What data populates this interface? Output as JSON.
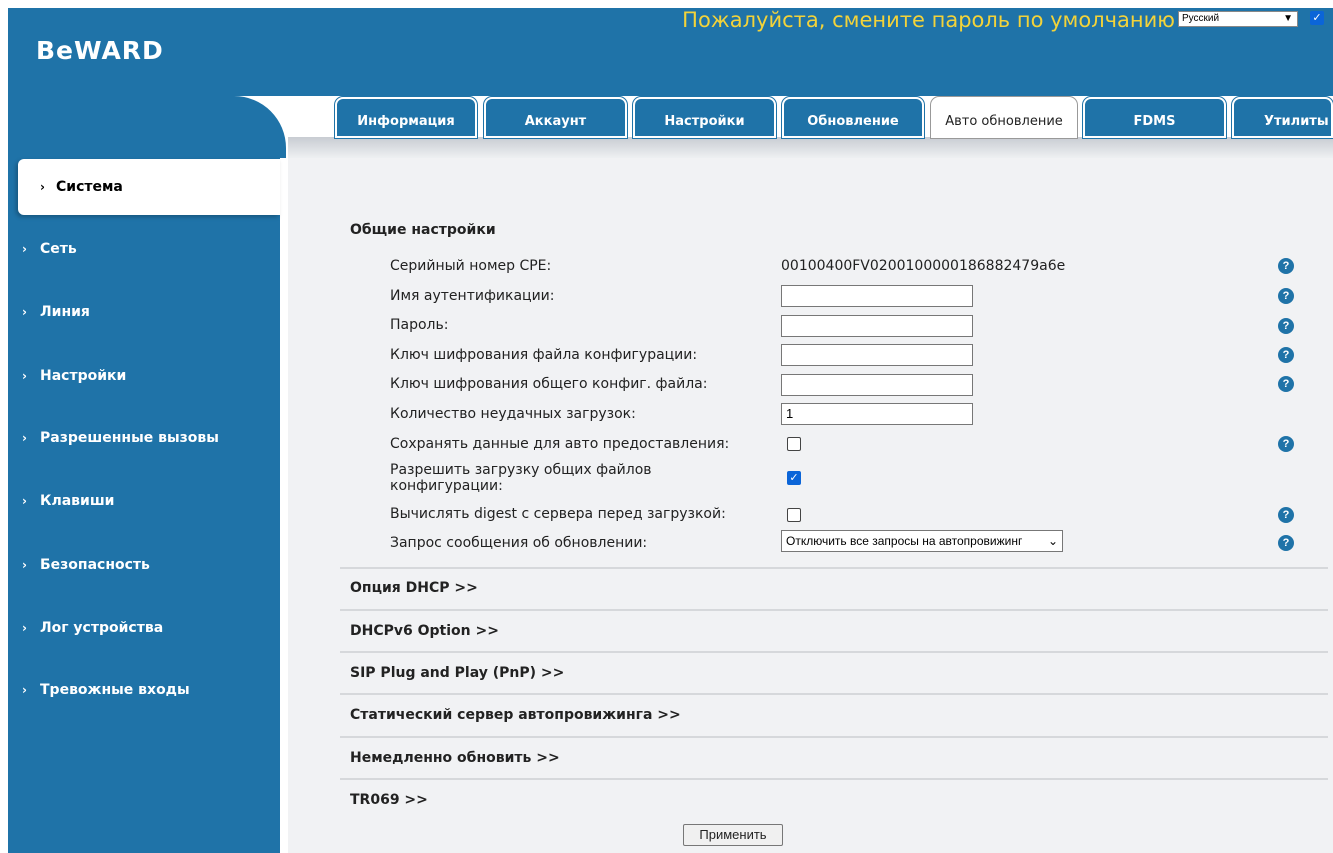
{
  "header": {
    "logo": "BeWARD",
    "password_warning": "Пожалуйста, смените пароль по умолчанию",
    "language": "Русский"
  },
  "sidebar": {
    "items": [
      {
        "label": "Система",
        "active": true
      },
      {
        "label": "Сеть"
      },
      {
        "label": "Линия"
      },
      {
        "label": "Настройки"
      },
      {
        "label": "Разрешенные вызовы"
      },
      {
        "label": "Клавиши"
      },
      {
        "label": "Безопасность"
      },
      {
        "label": "Лог устройства"
      },
      {
        "label": "Тревожные входы"
      }
    ]
  },
  "tabs": [
    {
      "label": "Информация"
    },
    {
      "label": "Аккаунт"
    },
    {
      "label": "Настройки"
    },
    {
      "label": "Обновление"
    },
    {
      "label": "Авто обновление",
      "active": true
    },
    {
      "label": "FDMS"
    },
    {
      "label": "Утилиты"
    }
  ],
  "general": {
    "title": "Общие настройки",
    "serial_label": "Серийный номер CPE:",
    "serial_value": "00100400FV0200100000186882479a6e",
    "auth_name_label": "Имя аутентификации:",
    "auth_name_value": "",
    "password_label": "Пароль:",
    "password_value": "",
    "cfg_key_label": "Ключ шифрования файла конфигурации:",
    "cfg_key_value": "",
    "common_cfg_key_label": "Ключ шифрования общего конфиг. файла:",
    "common_cfg_key_value": "",
    "fail_count_label": "Количество неудачных загрузок:",
    "fail_count_value": "1",
    "save_data_label": "Сохранять данные для авто предоставления:",
    "save_data_checked": false,
    "allow_common_label": "Разрешить загрузку общих файлов конфигурации:",
    "allow_common_checked": true,
    "digest_label": "Вычислять digest с сервера перед загрузкой:",
    "digest_checked": false,
    "update_request_label": "Запрос сообщения об обновлении:",
    "update_request_value": "Отключить все запросы на автопровижинг"
  },
  "sections": [
    "Опция DHCP >>",
    "DHCPv6 Option >>",
    "SIP Plug and Play (PnP) >>",
    "Статический сервер автопровижинга >>",
    "Немедленно обновить >>",
    "TR069 >>"
  ],
  "apply_label": "Применить",
  "colors": {
    "brand_blue": "#1f73a8",
    "warning_yellow": "#f3d33a",
    "content_bg": "#f1f2f4",
    "checkbox_blue": "#0b65d8"
  }
}
